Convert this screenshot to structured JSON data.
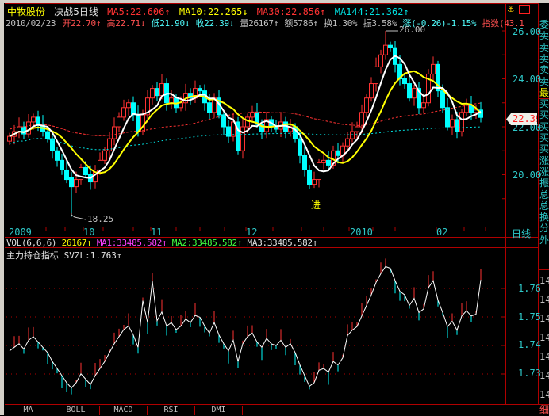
{
  "header": {
    "stock_name": "中牧股份",
    "formula": "决战5日线",
    "ma5": "MA5:22.606↑",
    "ma10": "MA10:22.265↓",
    "ma30": "MA30:22.856↑",
    "ma144": "MA144:21.362↑",
    "date": "2010/02/23",
    "open": "开22.70↑",
    "high": "高22.71↓",
    "low": "低21.90↓",
    "close": "收22.39↓",
    "volume": "量26167↑",
    "amount": "额5786↑",
    "turnover": "换1.30%",
    "amplitude": "振3.58%",
    "change": "涨(-0.26)-1.15%",
    "index": "指数(43.1"
  },
  "price_axis": {
    "ticks": [
      "26.00",
      "24.00",
      "22.00",
      "20.00"
    ],
    "current": "22.39",
    "period": "日线"
  },
  "date_axis": [
    "2009",
    "10",
    "11",
    "12",
    "2010",
    "02"
  ],
  "annotations": {
    "low_label": "18.25",
    "high_label": "26.00",
    "signal": "进"
  },
  "vol_header": {
    "name": "VOL(6,6,6)",
    "value": "26167↑",
    "ma1": "MA1:33485.582↑",
    "ma2": "MA2:33485.582↑",
    "ma3": "MA3:33485.582↑"
  },
  "indicator_header": {
    "name": "主力持仓指标",
    "value": "SVZL:1.763↑"
  },
  "indicator_axis": [
    "1.76",
    "1.75",
    "1.74",
    "1.73"
  ],
  "right_column": [
    "委",
    "卖",
    "卖",
    "卖",
    "卖",
    "卖",
    "最",
    "买",
    "买",
    "买",
    "买",
    "买",
    "涨",
    "涨",
    "振",
    "总",
    "总",
    "换",
    "分",
    "外"
  ],
  "right_column_numbers": [
    "14",
    "14",
    "14",
    "14",
    "14",
    "14",
    "14"
  ],
  "right_bottom": "细",
  "tabs": [
    "MA",
    "BOLL",
    "MACD",
    "RSI",
    "DMI"
  ],
  "colors": {
    "up": "#ff3232",
    "down": "#00ffff",
    "ma5": "#ffffff",
    "ma10": "#ffff00",
    "ma30": "#ff3232",
    "ma144": "#00e0e0",
    "axis": "#b00000"
  },
  "chart_data": {
    "type": "candlestick",
    "period": "daily",
    "ylim": [
      18,
      26.4
    ],
    "open": [
      21.4,
      21.6,
      21.8,
      22.0,
      21.7,
      22.2,
      22.4,
      22.1,
      21.8,
      21.5,
      21.0,
      20.6,
      20.2,
      19.9,
      19.5,
      19.8,
      20.3,
      20.0,
      19.7,
      20.2,
      20.6,
      21.0,
      21.5,
      22.0,
      22.4,
      22.8,
      23.0,
      22.5,
      21.8,
      22.5,
      23.2,
      23.6,
      23.3,
      23.8,
      23.0,
      23.2,
      22.8,
      23.0,
      23.4,
      23.2,
      23.6,
      23.5,
      23.0,
      22.6,
      23.2,
      22.5,
      22.0,
      21.6,
      22.2,
      21.0,
      22.0,
      22.4,
      22.6,
      22.1,
      21.8,
      22.3,
      22.0,
      21.9,
      22.2,
      21.8,
      22.0,
      21.5,
      20.8,
      20.2,
      19.6,
      19.8,
      20.5,
      20.6,
      20.4,
      21.0,
      20.8,
      21.2,
      21.5,
      21.8,
      22.0,
      22.6,
      23.2,
      23.8,
      24.5,
      25.0,
      25.4,
      25.3,
      24.6,
      24.0,
      23.8,
      23.2,
      23.6,
      22.8,
      23.0,
      24.2,
      24.6,
      23.5,
      22.8,
      22.0,
      22.3,
      21.8,
      22.6,
      22.9,
      22.6,
      22.7
    ],
    "close": [
      21.6,
      21.8,
      22.0,
      21.7,
      22.2,
      22.4,
      22.1,
      21.8,
      21.5,
      21.0,
      20.6,
      20.2,
      19.8,
      19.5,
      19.8,
      20.3,
      20.0,
      19.7,
      20.2,
      20.6,
      21.0,
      21.5,
      22.0,
      22.4,
      22.8,
      23.0,
      22.5,
      21.8,
      22.5,
      23.2,
      23.6,
      23.3,
      23.8,
      23.0,
      23.2,
      22.8,
      23.0,
      23.4,
      23.2,
      23.6,
      23.5,
      23.0,
      22.6,
      23.2,
      22.5,
      22.0,
      21.6,
      22.2,
      21.0,
      22.0,
      22.4,
      22.6,
      22.1,
      21.8,
      22.3,
      22.0,
      21.9,
      22.2,
      21.8,
      22.0,
      21.5,
      20.8,
      20.2,
      19.6,
      19.8,
      20.5,
      20.6,
      20.4,
      21.0,
      20.8,
      21.2,
      21.5,
      21.8,
      22.0,
      22.6,
      23.2,
      23.8,
      24.5,
      25.0,
      25.4,
      25.3,
      24.6,
      24.0,
      23.8,
      23.2,
      23.6,
      22.8,
      23.0,
      24.2,
      24.6,
      23.5,
      22.8,
      22.0,
      22.3,
      21.8,
      22.6,
      22.9,
      22.6,
      22.7,
      22.39
    ],
    "low_point": 18.25,
    "high_point": 26.0,
    "indicator": {
      "name": "SVZL",
      "last": 1.763,
      "ylim": [
        1.72,
        1.77
      ]
    }
  }
}
